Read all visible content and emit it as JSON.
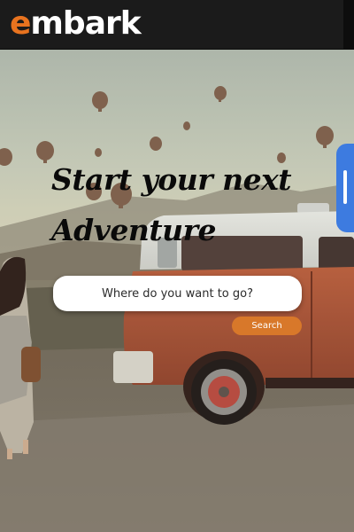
{
  "navbar": {
    "logo_accent": "e",
    "logo_rest": "mbark",
    "accent_color": "#e8731f"
  },
  "hero": {
    "headline_line1": "Start your next",
    "headline_line2": "Adventure",
    "search_placeholder": "Where do you want to go?",
    "search_button_label": "Search",
    "button_color": "#d8782a"
  },
  "side_tab": {
    "icon": "drag-handle-icon",
    "color": "#3d7be0"
  }
}
